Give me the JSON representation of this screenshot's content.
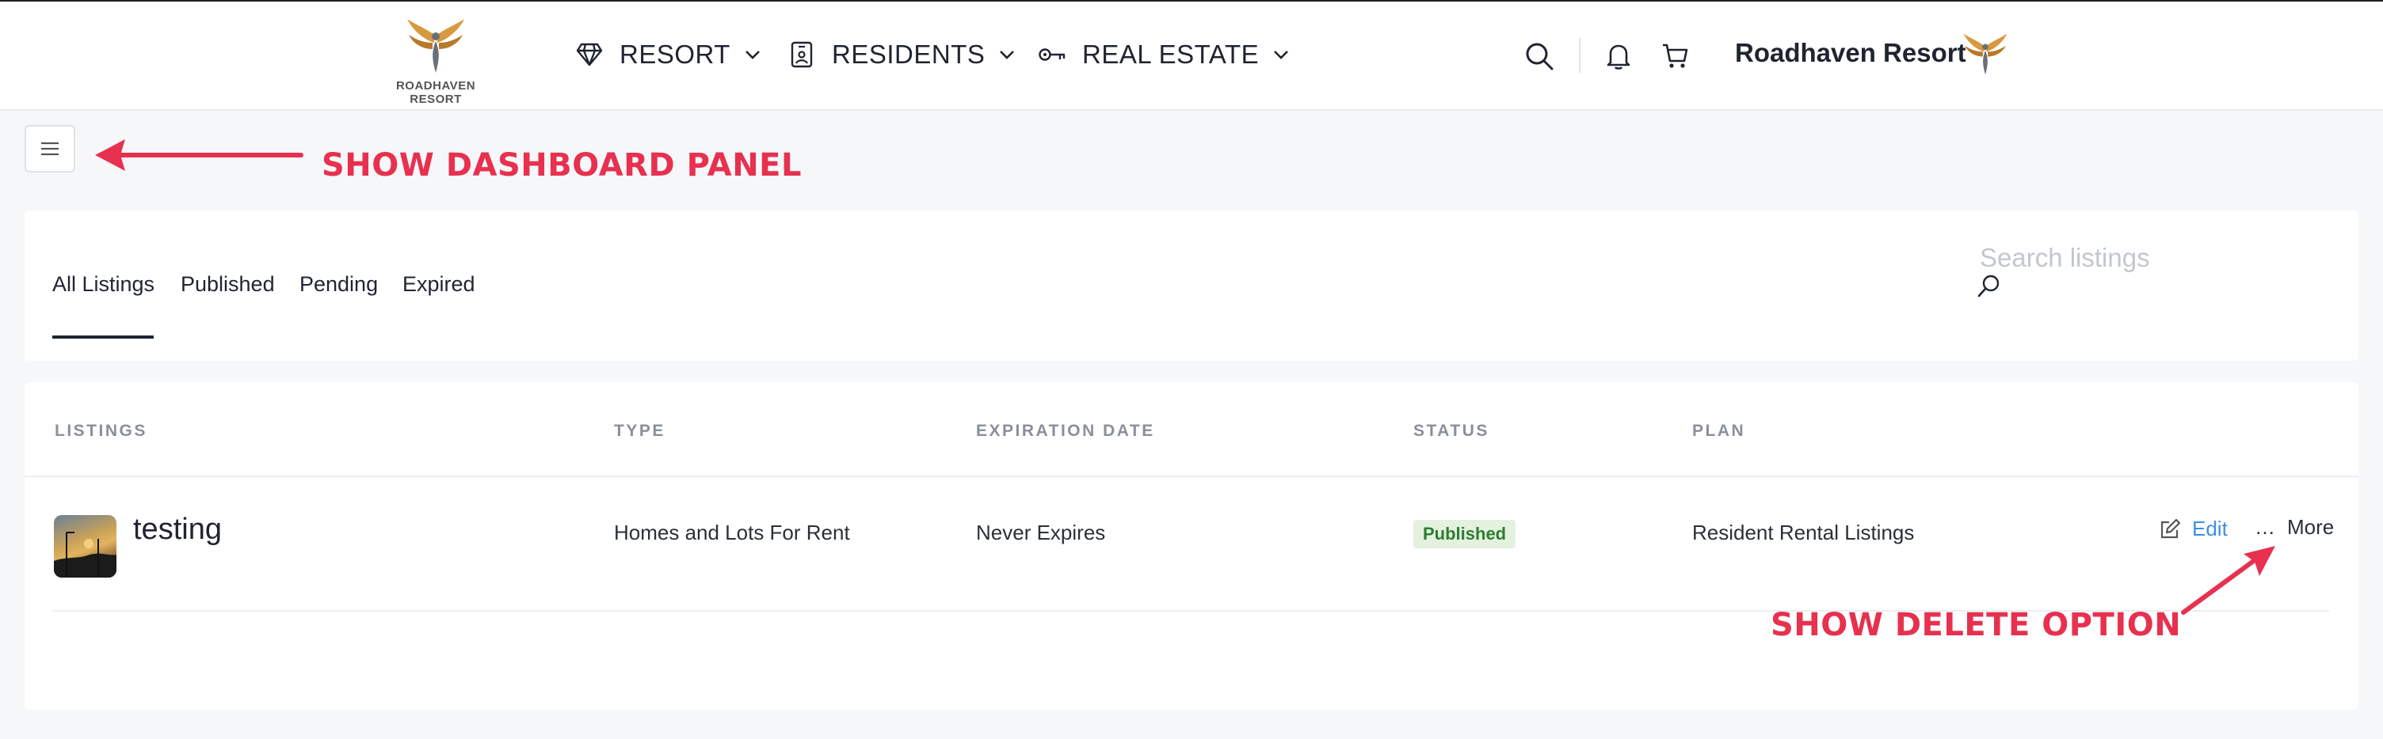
{
  "header": {
    "logo_text": "ROADHAVEN RESORT",
    "nav": [
      {
        "label": "RESORT",
        "icon": "diamond-icon"
      },
      {
        "label": "RESIDENTS",
        "icon": "id-badge-icon"
      },
      {
        "label": "REAL ESTATE",
        "icon": "key-icon"
      }
    ],
    "brand_name": "Roadhaven Resort"
  },
  "annotations": {
    "dashboard": "SHOW DASHBOARD PANEL",
    "delete": "SHOW DELETE OPTION"
  },
  "tabs": [
    {
      "label": "All Listings",
      "active": true
    },
    {
      "label": "Published",
      "active": false
    },
    {
      "label": "Pending",
      "active": false
    },
    {
      "label": "Expired",
      "active": false
    }
  ],
  "search": {
    "placeholder": "Search listings"
  },
  "table": {
    "columns": [
      "LISTINGS",
      "TYPE",
      "EXPIRATION DATE",
      "STATUS",
      "PLAN"
    ],
    "rows": [
      {
        "title": "testing",
        "type": "Homes and Lots For Rent",
        "expiration": "Never Expires",
        "status": "Published",
        "plan": "Resident Rental Listings",
        "actions": {
          "edit": "Edit",
          "more": "More"
        }
      }
    ]
  },
  "colors": {
    "annotation": "#e8304f",
    "link": "#3d8ee6",
    "published_badge_bg": "#e3f1de",
    "published_badge_text": "#2e7d32"
  }
}
